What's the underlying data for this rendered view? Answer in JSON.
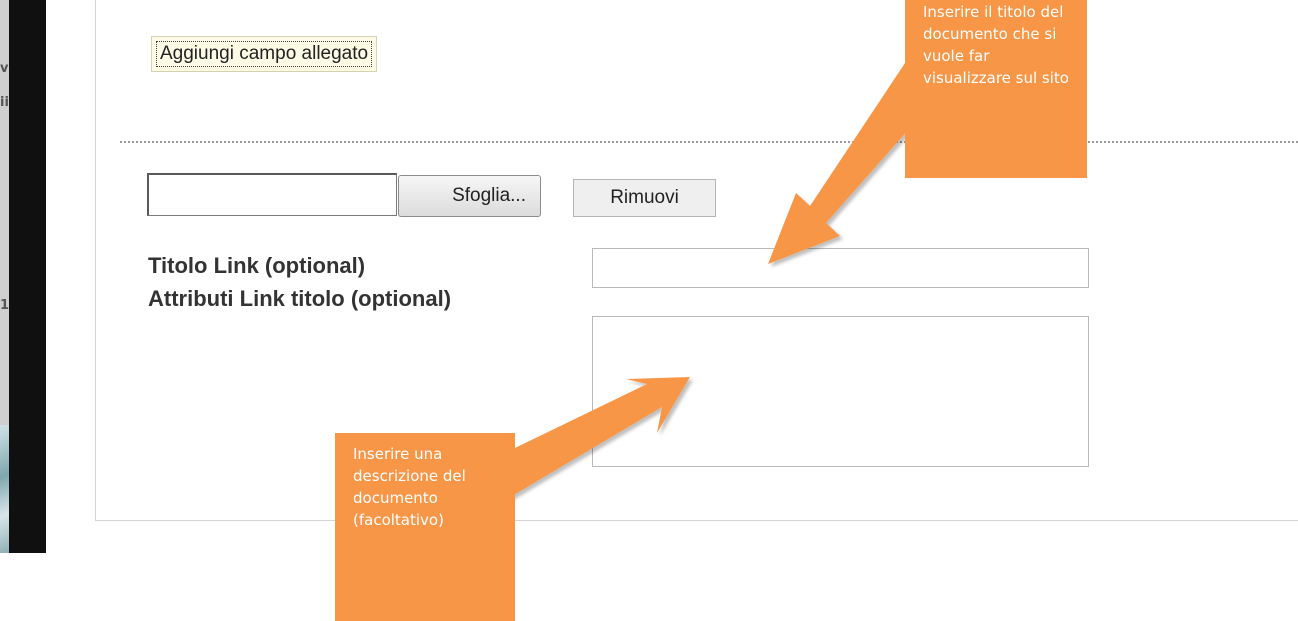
{
  "left_fragments": [
    "v",
    "ii",
    "1"
  ],
  "form": {
    "add_attachment_button": "Aggiungi campo allegato",
    "browse_button": "Sfoglia...",
    "remove_button": "Rimuovi",
    "title_link_label": "Titolo Link (optional)",
    "link_title_attributes_label": "Attributi Link titolo (optional)",
    "file_value": "",
    "title_value": "",
    "description_value": ""
  },
  "callouts": {
    "title_hint": "Inserire il titolo del documento che si vuole far visualizzare sul sito",
    "description_hint": "Inserire una descrizione del documento (facoltativo)"
  },
  "colors": {
    "callout_orange": "#f79646",
    "button_highlight": "#fdfbe5"
  }
}
